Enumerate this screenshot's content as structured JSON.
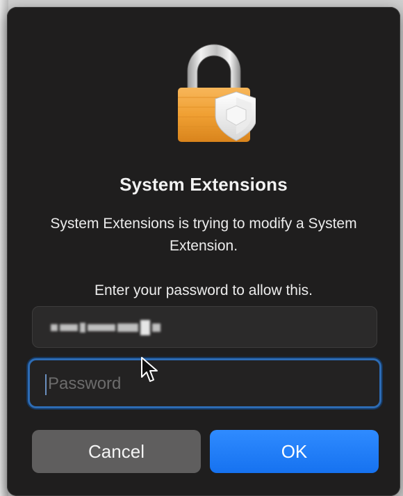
{
  "dialog": {
    "title": "System Extensions",
    "message": "System Extensions is trying to modify a System Extension.",
    "prompt": "Enter your password to allow this."
  },
  "fields": {
    "username": {
      "value": "",
      "obscured": true
    },
    "password": {
      "value": "",
      "placeholder": "Password",
      "focused": true
    }
  },
  "buttons": {
    "cancel_label": "Cancel",
    "ok_label": "OK"
  },
  "icons": {
    "dialog_icon": "lock-icon",
    "pointer": "mouse-pointer-icon"
  },
  "colors": {
    "dialog_background": "#1f1e1e",
    "lock_body": "#f0a33a",
    "focus_ring": "#2d6cb5",
    "ok_button": "#1672f0",
    "cancel_button": "#5f5e5e"
  }
}
